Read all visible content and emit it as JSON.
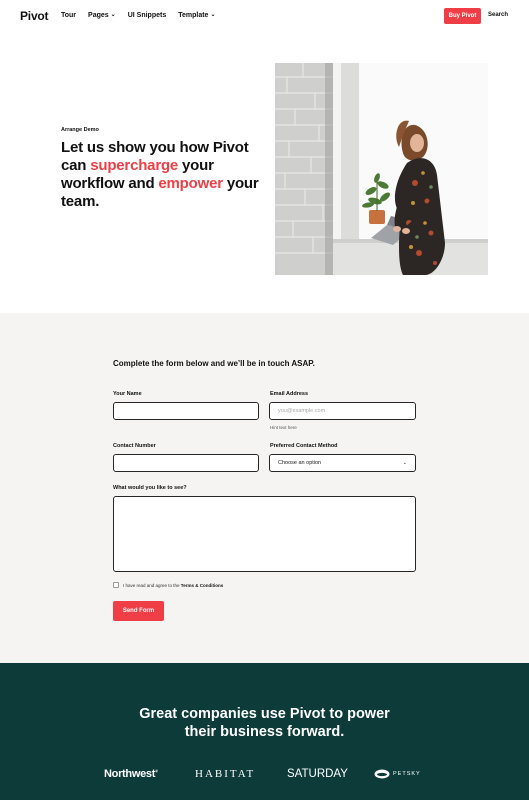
{
  "nav": {
    "brand": "Pivot",
    "items": [
      {
        "label": "Tour",
        "has_dropdown": false
      },
      {
        "label": "Pages",
        "has_dropdown": true
      },
      {
        "label": "UI Snippets",
        "has_dropdown": false
      },
      {
        "label": "Template",
        "has_dropdown": true
      }
    ],
    "buy_label": "Buy Pivot",
    "search_label": "Search"
  },
  "hero": {
    "eyebrow": "Arrange Demo",
    "title_part1": "Let us show you how Pivot can ",
    "title_accent1": "supercharge",
    "title_part2": " your workflow and ",
    "title_accent2": "empower",
    "title_part3": " your team."
  },
  "form": {
    "heading": "Complete the form below and we’ll be in touch ASAP.",
    "name_label": "Your Name",
    "email_label": "Email Address",
    "email_placeholder": "you@example.com",
    "email_hint": "Hint text here",
    "contact_label": "Contact Number",
    "method_label": "Preferred Contact Method",
    "method_selected": "Choose an option",
    "message_label": "What would you like to see?",
    "terms_text": "I have read and agree to the ",
    "terms_link": "Terms & Conditions",
    "submit_label": "Send Form"
  },
  "companies": {
    "title_line1": "Great companies use Pivot to power",
    "title_line2": "their business forward.",
    "logos": [
      "Northwest",
      "HABITAT",
      "SATURDAY",
      "PETSKY"
    ]
  },
  "colors": {
    "accent": "#ef3e45",
    "band": "#0d3b3a",
    "form_bg": "#f5f4f2"
  }
}
